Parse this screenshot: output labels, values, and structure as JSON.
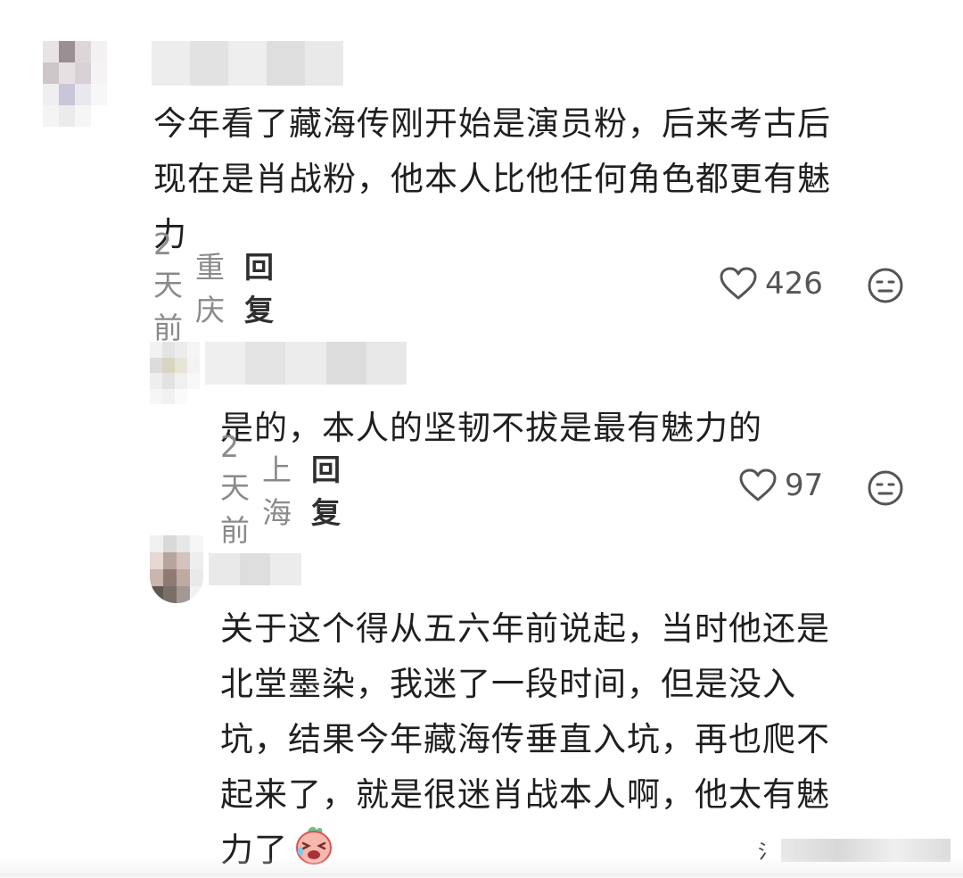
{
  "comments": [
    {
      "text": "今年看了藏海传刚开始是演员粉，后来考古后\n现在是肖战粉，他本人比他任何角色都更有魅\n力",
      "time": "2天前",
      "location": "重庆",
      "reply": "回复",
      "likes": "426"
    },
    {
      "text": "是的，本人的坚韧不拔是最有魅力的",
      "time": "2天前",
      "location": "上海",
      "reply": "回复",
      "likes": "97"
    },
    {
      "text": "关于这个得从五六年前说起，当时他还是\n北堂墨染，我迷了一段时间，但是没入\n坑，结果今年藏海传垂直入坑，再也爬不\n起来了，就是很迷肖战本人啊，他太有魅\n力了"
    }
  ],
  "icons": {
    "like": "heart-outline-icon",
    "dislike": "unhappy-face-icon",
    "emoji": "crying-emoji-icon"
  },
  "colors": {
    "meta": "#8a8a8a",
    "reply": "#2f2f2f",
    "text": "#1f1f1f"
  }
}
